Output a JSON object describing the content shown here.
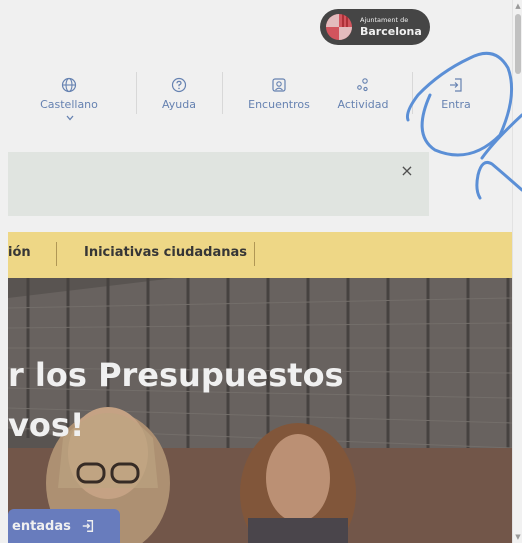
{
  "logo": {
    "line1": "Ajuntament de",
    "line2": "Barcelona"
  },
  "nav": {
    "language": "Castellano",
    "help": "Ayuda",
    "meetings": "Encuentros",
    "activity": "Actividad",
    "login": "Entra"
  },
  "banner": {
    "close_symbol": "×"
  },
  "tabs": {
    "tab1_partial": "ión",
    "tab2": "Iniciativas ciudadanas"
  },
  "hero": {
    "line1": "r los Presupuestos",
    "line2": "vos!",
    "cta_label": "entadas"
  },
  "colors": {
    "nav_text": "#6d8bbd",
    "tabs_bg": "#fde58f",
    "cta_bg": "#6f84c9",
    "annotation": "#5b8fd6"
  }
}
